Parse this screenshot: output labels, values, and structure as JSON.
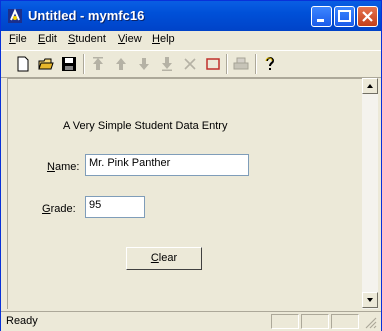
{
  "window": {
    "title": "Untitled - mymfc16"
  },
  "menu": [
    {
      "key": "F",
      "rest": "ile"
    },
    {
      "key": "E",
      "rest": "dit"
    },
    {
      "key": "S",
      "rest": "tudent"
    },
    {
      "key": "V",
      "rest": "iew"
    },
    {
      "key": "H",
      "rest": "elp"
    }
  ],
  "form": {
    "heading": "A Very Simple Student Data Entry",
    "name_label": {
      "key": "N",
      "rest": "ame:"
    },
    "name_value": "Mr. Pink Panther",
    "grade_label": {
      "key": "G",
      "rest": "rade:"
    },
    "grade_value": "95",
    "clear_button": {
      "key": "C",
      "rest": "lear"
    }
  },
  "status": {
    "text": "Ready"
  },
  "toolbar": {
    "icons": [
      "new-icon",
      "open-icon",
      "save-icon",
      "home-arrow-icon",
      "prev-arrow-icon",
      "next-arrow-icon",
      "end-arrow-icon",
      "delete-icon",
      "insert-icon",
      "print-icon",
      "help-icon"
    ]
  }
}
